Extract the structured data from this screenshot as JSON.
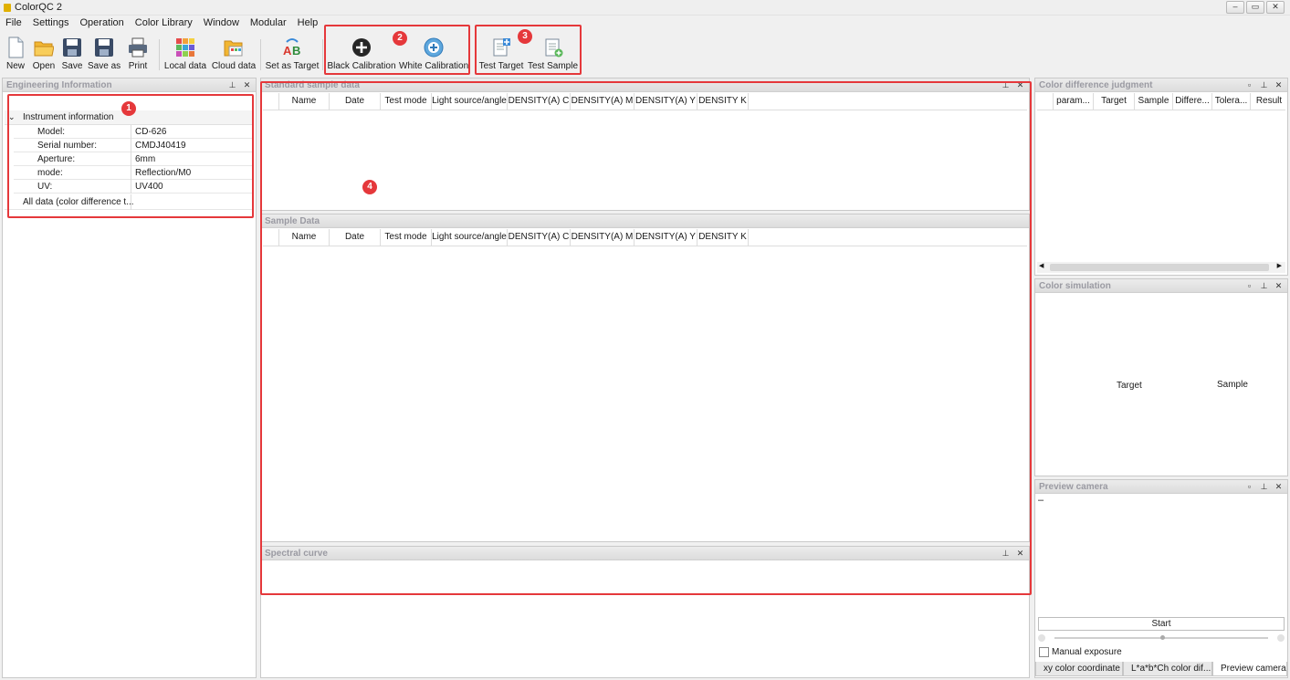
{
  "app": {
    "title": "ColorQC 2"
  },
  "window_controls": {
    "minimize": "–",
    "restore": "▭",
    "close": "✕"
  },
  "menu": [
    "File",
    "Settings",
    "Operation",
    "Color Library",
    "Window",
    "Modular",
    "Help"
  ],
  "toolbar": {
    "new": "New",
    "open": "Open",
    "save": "Save",
    "save_as": "Save as",
    "print": "Print",
    "local_data": "Local data",
    "cloud_data": "Cloud data",
    "set_as_target": "Set as Target",
    "black_calibration": "Black Calibration",
    "white_calibration": "White Calibration",
    "test_target": "Test Target",
    "test_sample": "Test Sample"
  },
  "badges": [
    "1",
    "2",
    "3",
    "4"
  ],
  "engineering": {
    "title": "Engineering Information",
    "group": "Instrument information",
    "rows": [
      {
        "key": "Model:",
        "value": "CD-626"
      },
      {
        "key": "Serial number:",
        "value": "CMDJ40419"
      },
      {
        "key": "Aperture:",
        "value": "6mm"
      },
      {
        "key": "mode:",
        "value": "Reflection/M0"
      },
      {
        "key": "UV:",
        "value": "UV400"
      }
    ],
    "all_data": "All data (color difference t..."
  },
  "standard": {
    "title": "Standard sample data",
    "columns": [
      "Name",
      "Date",
      "Test mode",
      "Light source/angle",
      "DENSITY(A) C",
      "DENSITY(A) M",
      "DENSITY(A) Y",
      "DENSITY K"
    ]
  },
  "sample": {
    "title": "Sample Data",
    "columns": [
      "Name",
      "Date",
      "Test mode",
      "Light source/angle",
      "DENSITY(A) C",
      "DENSITY(A) M",
      "DENSITY(A) Y",
      "DENSITY K"
    ]
  },
  "spectral": {
    "title": "Spectral curve"
  },
  "color_diff": {
    "title": "Color difference judgment",
    "columns": [
      "param...",
      "Target",
      "Sample",
      "Differe...",
      "Tolera...",
      "Result"
    ]
  },
  "color_sim": {
    "title": "Color simulation",
    "target": "Target",
    "sample": "Sample"
  },
  "preview": {
    "title": "Preview camera",
    "dash": "–",
    "start": "Start",
    "manual_exposure": "Manual exposure",
    "tabs": [
      "xy color coordinate",
      "L*a*b*Ch color dif...",
      "Preview camera"
    ]
  },
  "colors": {
    "accent_red": "#e5383b",
    "header_text": "#9a9aa2"
  }
}
